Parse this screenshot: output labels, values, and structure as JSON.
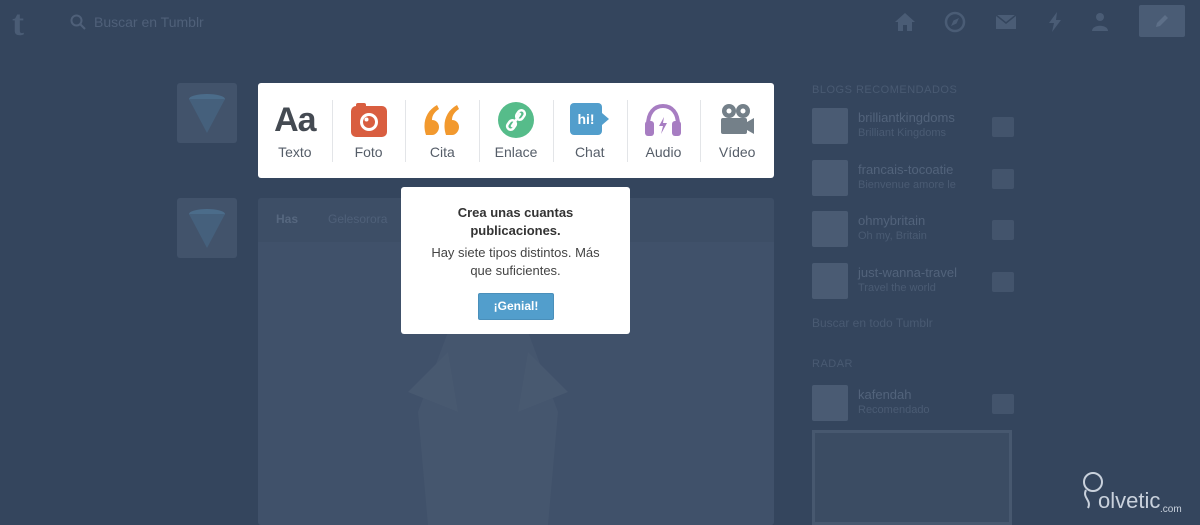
{
  "header": {
    "logo": "t",
    "search_placeholder": "Buscar en Tumblr",
    "icons": [
      "home-icon",
      "explore-icon",
      "inbox-icon",
      "activity-icon",
      "account-icon",
      "compose-icon"
    ]
  },
  "post_types": [
    {
      "label": "Texto",
      "icon": "text-icon",
      "color": "#444a52",
      "glyph": "Aa"
    },
    {
      "label": "Foto",
      "icon": "camera-icon",
      "color": "#d95e40"
    },
    {
      "label": "Cita",
      "icon": "quote-icon",
      "color": "#f2992e"
    },
    {
      "label": "Enlace",
      "icon": "link-icon",
      "color": "#56bc8a"
    },
    {
      "label": "Chat",
      "icon": "chat-icon",
      "color": "#529ecc",
      "glyph": "hi!"
    },
    {
      "label": "Audio",
      "icon": "headphones-icon",
      "color": "#a77dc2"
    },
    {
      "label": "Vídeo",
      "icon": "video-camera-icon",
      "color": "#748089"
    }
  ],
  "tooltip": {
    "title": "Crea unas cuantas publicaciones.",
    "body": "Hay siete tipos distintos. Más que suficientes.",
    "button": "¡Genial!"
  },
  "post": {
    "author": "Has",
    "reblog": "Gelesorora"
  },
  "sidebar": {
    "title": "BLOGS RECOMENDADOS",
    "blogs": [
      {
        "name": "brilliantkingdoms",
        "sub": "Brilliant Kingdoms"
      },
      {
        "name": "francais-tocoatie",
        "sub": "Bienvenue amore le"
      },
      {
        "name": "ohmybritain",
        "sub": "Oh my, Britain"
      },
      {
        "name": "just-wanna-travel",
        "sub": "Travel the world"
      }
    ],
    "more_link": "Buscar en todo Tumblr",
    "radar_title": "RADAR",
    "radar_blog": {
      "name": "kafendah",
      "sub": "Recomendado"
    }
  },
  "watermark": {
    "text": "olvetic",
    "domain": ".com"
  }
}
